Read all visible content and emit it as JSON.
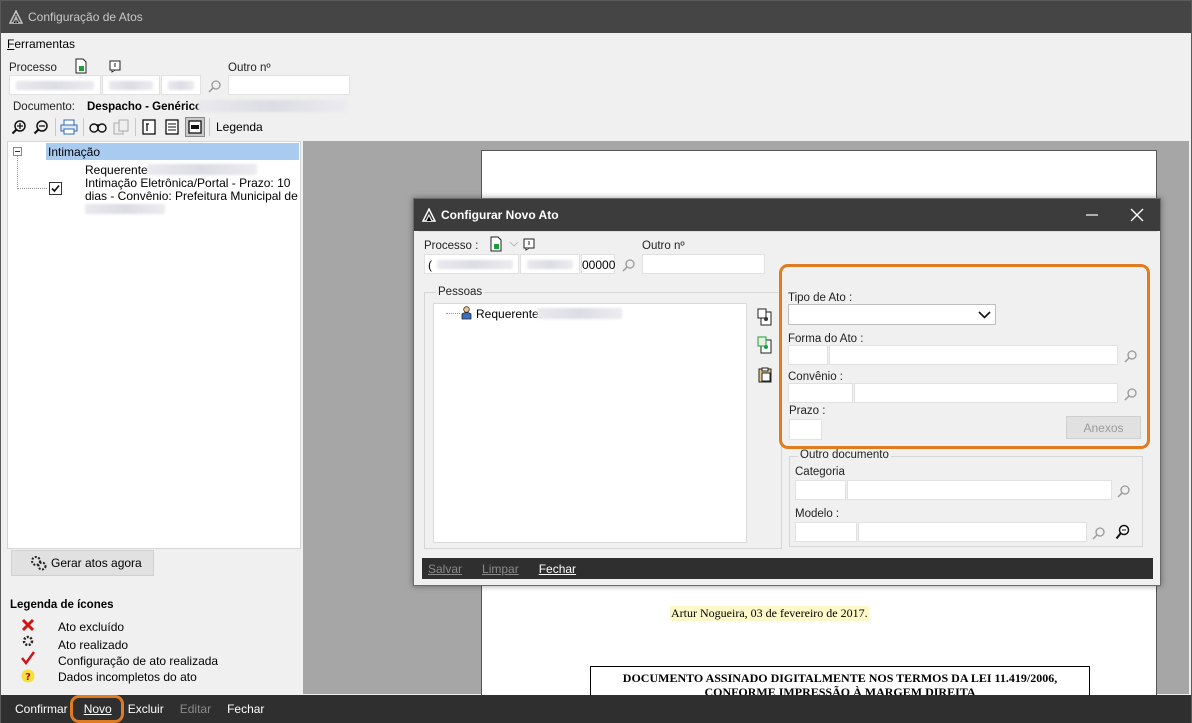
{
  "window": {
    "title": "Configuração de Atos"
  },
  "menu": {
    "ferramentas": "Ferramentas",
    "ferramentas_accel": "F",
    "ferramentas_rest": "erramentas"
  },
  "processo": {
    "label": "Processo",
    "outro_label": "Outro nº",
    "outro_value": ""
  },
  "documento": {
    "label": "Documento:",
    "value": "Despacho - Genérico"
  },
  "toolbar": {
    "legenda": "Legenda"
  },
  "tree": {
    "root": "Intimação",
    "requerente": "Requerente",
    "line1": "Intimação Eletrônica/Portal - Prazo: 10",
    "line2": "dias - Convênio: Prefeitura Municipal de"
  },
  "gerar": {
    "label": "Gerar atos agora"
  },
  "legend": {
    "title": "Legenda de ícones",
    "items": [
      "Ato excluído",
      "Ato realizado",
      "Configuração de ato realizada",
      "Dados incompletos do ato"
    ]
  },
  "bottombar": {
    "confirmar": "Confirmar",
    "novo": "Novo",
    "excluir": "Excluir",
    "editar": "Editar",
    "fechar": "Fechar"
  },
  "document": {
    "date_line": "Artur Nogueira, 03 de fevereiro de 2017.",
    "sig_line1": "DOCUMENTO ASSINADO DIGITALMENTE NOS TERMOS DA LEI 11.419/2006,",
    "sig_line2": "CONFORME IMPRESSÃO À MARGEM DIREITA"
  },
  "dialog": {
    "title": "Configurar Novo Ato",
    "processo_label": "Processo :",
    "processo_prefix": "(",
    "processo_suffix": "00000",
    "outro_label": "Outro nº",
    "pessoas_label": "Pessoas",
    "requerente_label": "Requerente:",
    "tipo_label": "Tipo de Ato :",
    "forma_label": "Forma do Ato :",
    "convenio_label": "Convênio :",
    "prazo_label": "Prazo :",
    "anexos_label": "Anexos",
    "outro_doc_label": "Outro documento",
    "categoria_label": "Categoria",
    "modelo_label": "Modelo :",
    "salvar": "Salvar",
    "limpar": "Limpar",
    "fechar": "Fechar"
  },
  "colors": {
    "orange": "#e07b1f",
    "selection": "#a9cbef",
    "titlebar": "#454545"
  }
}
